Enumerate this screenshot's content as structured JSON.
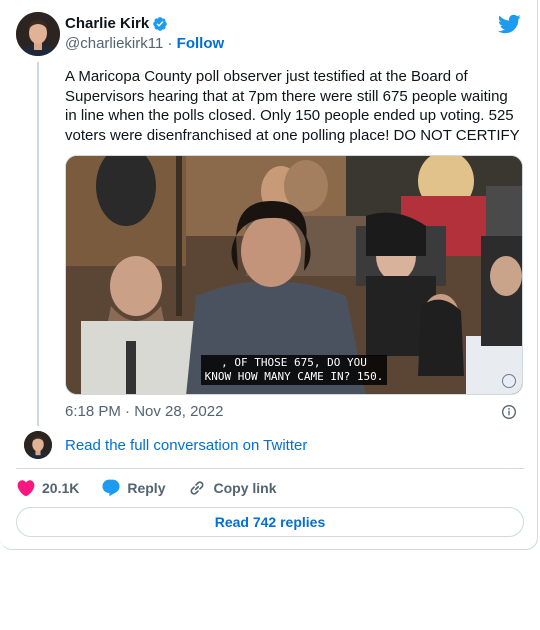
{
  "author": {
    "display_name": "Charlie Kirk",
    "handle": "@charliekirk11",
    "separator": "·",
    "follow_label": "Follow",
    "verified_icon": "verified-badge-icon"
  },
  "tweet": {
    "text": "A Maricopa County poll observer just testified at the Board of Supervisors hearing that at 7pm there were still 675 people waiting in line when the polls closed. Only 150 people ended up voting. 525 voters were disenfranchised at one polling place! DO NOT CERTIFY",
    "media_caption": ", OF THOSE 675, DO YOU\nKNOW HOW MANY CAME IN? 150.",
    "time": "6:18 PM",
    "meta_separator": "·",
    "date": "Nov 28, 2022"
  },
  "conversation": {
    "link_label": "Read the full conversation on Twitter"
  },
  "actions": {
    "like_count": "20.1K",
    "reply_label": "Reply",
    "copy_link_label": "Copy link"
  },
  "footer": {
    "read_replies_label": "Read 742 replies"
  },
  "colors": {
    "twitter_blue": "#1d9bf0",
    "link_blue": "#006fd6",
    "like_pink": "#f91880",
    "text_primary": "#0f1419",
    "text_secondary": "#536471",
    "border": "#cfd9de"
  },
  "icons": [
    "twitter-bird-icon",
    "info-icon",
    "heart-icon",
    "speech-bubble-icon",
    "link-icon"
  ]
}
